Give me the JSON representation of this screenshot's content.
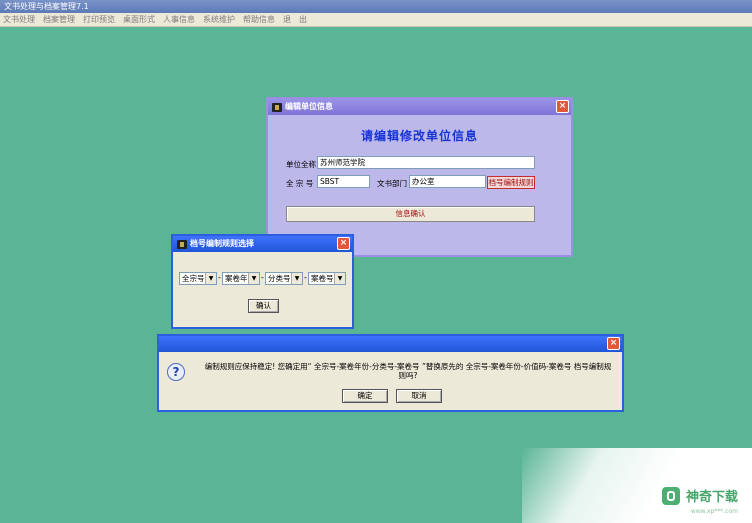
{
  "app": {
    "title": "文书处理与档案管理7.1"
  },
  "menu": [
    "文书处理",
    "档案管理",
    "打印预览",
    "桌面形式",
    "人事信息",
    "系统维护",
    "帮助信息",
    "退",
    "出"
  ],
  "unit_dialog": {
    "title": "编辑单位信息",
    "heading": "请编辑修改单位信息",
    "fullname_label": "单位全称",
    "fullname_value": "苏州师范学院",
    "fonds_label": "全 宗 号",
    "fonds_value": "SBST",
    "dept_label": "文书部门",
    "dept_value": "办公室",
    "rule_button": "档号编制规则",
    "confirm_button": "信息确认"
  },
  "rule_dialog": {
    "title": "档号编制规则选择",
    "combos": [
      "全宗号",
      "案卷年",
      "分类号",
      "案卷号"
    ],
    "separator": "-",
    "ok_button": "确认"
  },
  "confirm_dialog": {
    "message": "编制规则应保持稳定! 您确定用“ 全宗号-案卷年份-分类号-案卷号 ”替换原先的 全宗号-案卷年份-价值码-案卷号 档号编制规则吗?",
    "ok_button": "确定",
    "cancel_button": "取消"
  },
  "watermark": {
    "brand": "神奇下载",
    "url": "www.xp***.com"
  }
}
